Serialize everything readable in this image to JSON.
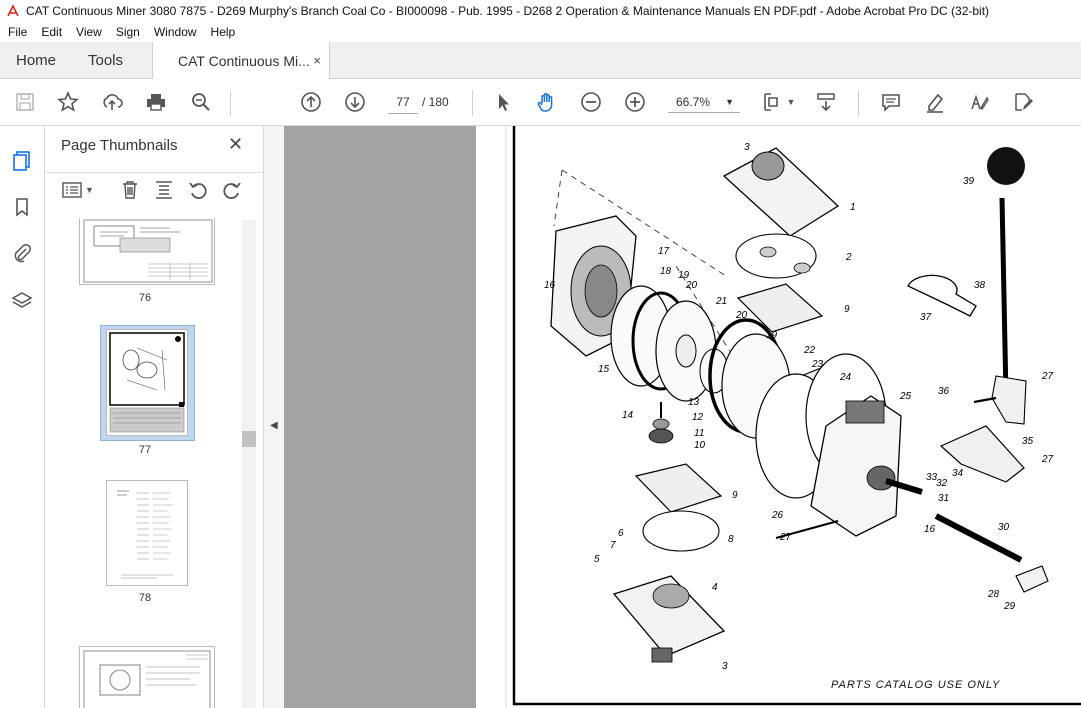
{
  "window": {
    "title": "CAT Continuous Miner 3080 7875 - D269 Murphy's Branch Coal Co - BI000098 - Pub. 1995 - D268 2 Operation & Maintenance Manuals EN PDF.pdf - Adobe Acrobat Pro DC (32-bit)"
  },
  "menu": [
    "File",
    "Edit",
    "View",
    "Sign",
    "Window",
    "Help"
  ],
  "tabs": {
    "home": "Home",
    "tools": "Tools",
    "document": "CAT Continuous Mi...",
    "close": "×"
  },
  "toolbar": {
    "current_page": "77",
    "page_total": "/ 180",
    "zoom": "66.7%",
    "icons": [
      "save-icon",
      "bookmark-star-icon",
      "upload-icon",
      "print-icon",
      "zoom-search-icon",
      "prev-page-icon",
      "next-page-icon",
      "select-cursor-icon",
      "hand-tool-icon",
      "zoom-out-icon",
      "zoom-in-icon",
      "page-fit-icon",
      "scroll-mode-icon",
      "comment-icon",
      "highlight-icon",
      "sign-icon",
      "edit-pdf-icon"
    ]
  },
  "panel": {
    "title": "Page Thumbnails",
    "close": "✕",
    "thumbnails": [
      {
        "label": "76",
        "selected": false
      },
      {
        "label": "77",
        "selected": true
      },
      {
        "label": "78",
        "selected": false
      }
    ]
  },
  "document": {
    "footer_note": "PARTS CATALOG USE ONLY",
    "part_numbers": [
      "1",
      "2",
      "3",
      "3",
      "4",
      "5",
      "6",
      "7",
      "8",
      "9",
      "9",
      "10",
      "11",
      "12",
      "13",
      "14",
      "15",
      "16",
      "16",
      "17",
      "18",
      "19",
      "19",
      "20",
      "20",
      "21",
      "22",
      "23",
      "24",
      "25",
      "26",
      "27",
      "27",
      "27",
      "28",
      "29",
      "30",
      "31",
      "32",
      "33",
      "34",
      "35",
      "36",
      "37",
      "38",
      "39"
    ]
  },
  "colors": {
    "accent": "#1473e6",
    "doc_background": "#a3a3a3"
  }
}
